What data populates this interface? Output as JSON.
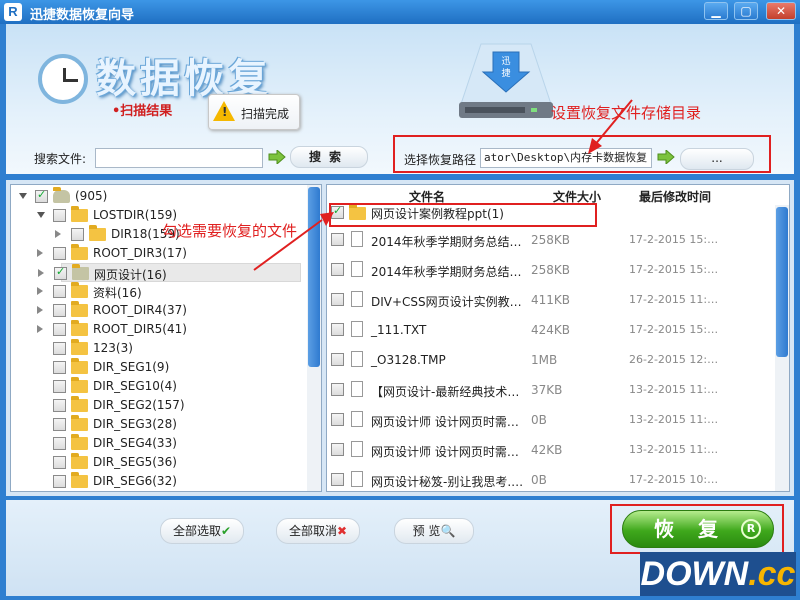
{
  "window": {
    "icon_letter": "R",
    "title": "迅捷数据恢复向导",
    "min": "▁",
    "max": "▢",
    "close": "✕"
  },
  "header": {
    "title": "数据恢复",
    "scan_label": "•扫描结果",
    "scan_status": "扫描完成",
    "annotation_path": "设置恢复文件存储目录",
    "annotation_select": "勾选需要恢复的文件"
  },
  "search": {
    "label": "搜索文件:",
    "value": "",
    "button": "搜索"
  },
  "path": {
    "label": "选择恢复路径",
    "value": "ator\\Desktop\\内存卡数据恢复",
    "browse": "..."
  },
  "tree": [
    {
      "label": "(905)",
      "depth": 0,
      "expander": "open",
      "checked": true,
      "icon": "drive"
    },
    {
      "label": "LOSTDIR(159)",
      "depth": 1,
      "expander": "open",
      "checked": false,
      "icon": "folder"
    },
    {
      "label": "DIR18(159)",
      "depth": 2,
      "expander": "closed",
      "checked": false,
      "icon": "folder"
    },
    {
      "label": "ROOT_DIR3(17)",
      "depth": 1,
      "expander": "closed",
      "checked": false,
      "icon": "folder"
    },
    {
      "label": "网页设计(16)",
      "depth": 1,
      "expander": "closed",
      "checked": true,
      "icon": "folder-grey",
      "selected": true
    },
    {
      "label": "资料(16)",
      "depth": 1,
      "expander": "closed",
      "checked": false,
      "icon": "folder"
    },
    {
      "label": "ROOT_DIR4(37)",
      "depth": 1,
      "expander": "closed",
      "checked": false,
      "icon": "folder"
    },
    {
      "label": "ROOT_DIR5(41)",
      "depth": 1,
      "expander": "closed",
      "checked": false,
      "icon": "folder"
    },
    {
      "label": "123(3)",
      "depth": 1,
      "expander": "none",
      "checked": false,
      "icon": "folder"
    },
    {
      "label": "DIR_SEG1(9)",
      "depth": 1,
      "expander": "none",
      "checked": false,
      "icon": "folder"
    },
    {
      "label": "DIR_SEG10(4)",
      "depth": 1,
      "expander": "none",
      "checked": false,
      "icon": "folder"
    },
    {
      "label": "DIR_SEG2(157)",
      "depth": 1,
      "expander": "none",
      "checked": false,
      "icon": "folder"
    },
    {
      "label": "DIR_SEG3(28)",
      "depth": 1,
      "expander": "none",
      "checked": false,
      "icon": "folder"
    },
    {
      "label": "DIR_SEG4(33)",
      "depth": 1,
      "expander": "none",
      "checked": false,
      "icon": "folder"
    },
    {
      "label": "DIR_SEG5(36)",
      "depth": 1,
      "expander": "none",
      "checked": false,
      "icon": "folder"
    },
    {
      "label": "DIR_SEG6(32)",
      "depth": 1,
      "expander": "none",
      "checked": false,
      "icon": "folder"
    }
  ],
  "files": {
    "headers": [
      "文件名",
      "文件大小",
      "最后修改时间"
    ],
    "rows": [
      {
        "name": "网页设计案例教程ppt(1)",
        "size": "",
        "date": "",
        "checked": true,
        "icon": "folder"
      },
      {
        "name": "2014年秋季学期财务总结…",
        "size": "258KB",
        "date": "17-2-2015 15:…",
        "checked": false,
        "icon": "doc"
      },
      {
        "name": "2014年秋季学期财务总结…",
        "size": "258KB",
        "date": "17-2-2015 15:…",
        "checked": false,
        "icon": "doc"
      },
      {
        "name": "DIV+CSS网页设计实例教…",
        "size": "411KB",
        "date": "17-2-2015 11:…",
        "checked": false,
        "icon": "doc"
      },
      {
        "name": "_111.TXT",
        "size": "424KB",
        "date": "17-2-2015 15:…",
        "checked": false,
        "icon": "doc"
      },
      {
        "name": "_O3128.TMP",
        "size": "1MB",
        "date": "26-2-2015 12:…",
        "checked": false,
        "icon": "doc"
      },
      {
        "name": "【网页设计-最新经典技术…",
        "size": "37KB",
        "date": "13-2-2015 11:…",
        "checked": false,
        "icon": "doc"
      },
      {
        "name": "网页设计师 设计网页时需…",
        "size": "0B",
        "date": "13-2-2015 11:…",
        "checked": false,
        "icon": "doc"
      },
      {
        "name": "网页设计师 设计网页时需…",
        "size": "42KB",
        "date": "13-2-2015 11:…",
        "checked": false,
        "icon": "doc"
      },
      {
        "name": "网页设计秘笈-别让我思考.…",
        "size": "0B",
        "date": "17-2-2015 10:…",
        "checked": false,
        "icon": "doc"
      }
    ]
  },
  "buttons": {
    "select_all": "全部选取",
    "deselect_all": "全部取消",
    "preview": "预 览",
    "recover": "恢复",
    "recover_badge": "R"
  },
  "watermark": {
    "main": "DOWN",
    "suffix": ".cc"
  },
  "colors": {
    "accent": "#2f7fd0",
    "annotation": "#e02020",
    "recover": "#3fa81c"
  }
}
